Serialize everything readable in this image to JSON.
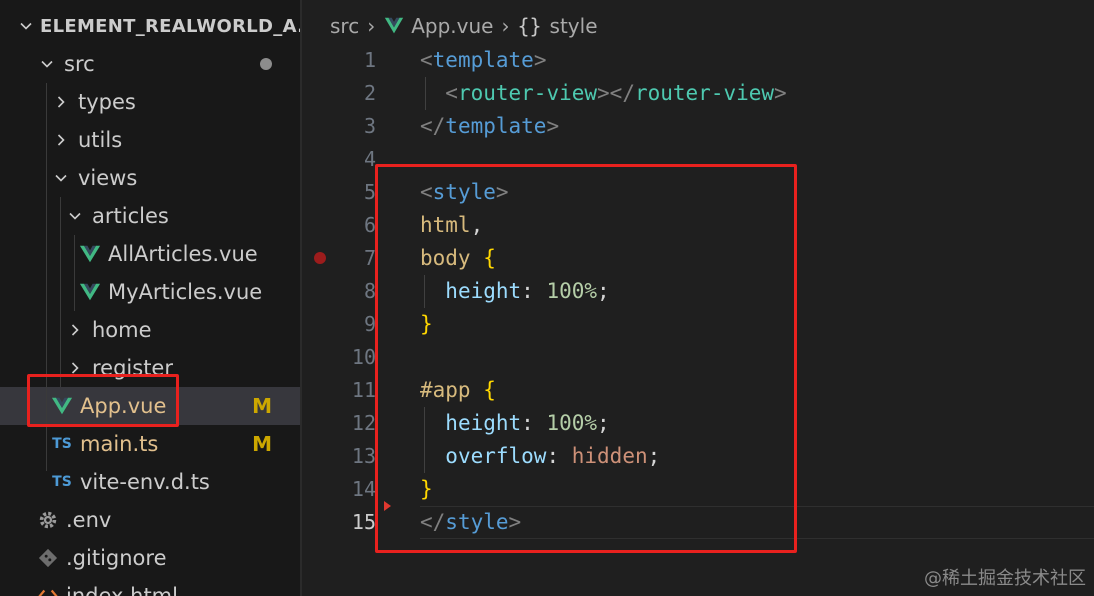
{
  "explorer": {
    "root_label": "ELEMENT_REALWORLD_A...",
    "items": [
      {
        "label": "src",
        "kind": "folder-open",
        "indent": 1
      },
      {
        "label": "types",
        "kind": "folder-closed",
        "indent": 2
      },
      {
        "label": "utils",
        "kind": "folder-closed",
        "indent": 2
      },
      {
        "label": "views",
        "kind": "folder-open",
        "indent": 2
      },
      {
        "label": "articles",
        "kind": "folder-open",
        "indent": 3
      },
      {
        "label": "AllArticles.vue",
        "kind": "vue",
        "indent": 4
      },
      {
        "label": "MyArticles.vue",
        "kind": "vue",
        "indent": 4
      },
      {
        "label": "home",
        "kind": "folder-closed",
        "indent": 3
      },
      {
        "label": "register",
        "kind": "folder-closed",
        "indent": 3
      },
      {
        "label": "App.vue",
        "kind": "vue",
        "indent": 2,
        "git": "M",
        "selected": true
      },
      {
        "label": "main.ts",
        "kind": "ts",
        "indent": 2,
        "git": "M"
      },
      {
        "label": "vite-env.d.ts",
        "kind": "ts",
        "indent": 2
      },
      {
        "label": ".env",
        "kind": "gear",
        "indent": 1
      },
      {
        "label": ".gitignore",
        "kind": "git",
        "indent": 1
      },
      {
        "label": "index.html",
        "kind": "html",
        "indent": 1
      }
    ],
    "ts_icon_text": "TS"
  },
  "breadcrumb": {
    "folder": "src",
    "file": "App.vue",
    "symbol_icon": "{}",
    "symbol": "style"
  },
  "code": {
    "active_line": 15,
    "lines": [
      [
        {
          "t": "<",
          "c": "#808080"
        },
        {
          "t": "template",
          "c": "#569cd6"
        },
        {
          "t": ">",
          "c": "#808080"
        }
      ],
      [
        {
          "t": "  ",
          "c": "#d4d4d4"
        },
        {
          "t": "<",
          "c": "#808080"
        },
        {
          "t": "router-view",
          "c": "#4ec9b0"
        },
        {
          "t": "></",
          "c": "#808080"
        },
        {
          "t": "router-view",
          "c": "#4ec9b0"
        },
        {
          "t": ">",
          "c": "#808080"
        }
      ],
      [
        {
          "t": "</",
          "c": "#808080"
        },
        {
          "t": "template",
          "c": "#569cd6"
        },
        {
          "t": ">",
          "c": "#808080"
        }
      ],
      [],
      [
        {
          "t": "<",
          "c": "#808080"
        },
        {
          "t": "style",
          "c": "#569cd6"
        },
        {
          "t": ">",
          "c": "#808080"
        }
      ],
      [
        {
          "t": "html",
          "c": "#d7ba7d"
        },
        {
          "t": ",",
          "c": "#d4d4d4"
        }
      ],
      [
        {
          "t": "body",
          "c": "#d7ba7d"
        },
        {
          "t": " ",
          "c": "#d4d4d4"
        },
        {
          "t": "{",
          "c": "#ffd700"
        }
      ],
      [
        {
          "t": "  ",
          "c": "#d4d4d4"
        },
        {
          "t": "height",
          "c": "#9cdcfe"
        },
        {
          "t": ": ",
          "c": "#d4d4d4"
        },
        {
          "t": "100%",
          "c": "#b5cea8"
        },
        {
          "t": ";",
          "c": "#d4d4d4"
        }
      ],
      [
        {
          "t": "}",
          "c": "#ffd700"
        }
      ],
      [],
      [
        {
          "t": "#app",
          "c": "#d7ba7d"
        },
        {
          "t": " ",
          "c": "#d4d4d4"
        },
        {
          "t": "{",
          "c": "#ffd700"
        }
      ],
      [
        {
          "t": "  ",
          "c": "#d4d4d4"
        },
        {
          "t": "height",
          "c": "#9cdcfe"
        },
        {
          "t": ": ",
          "c": "#d4d4d4"
        },
        {
          "t": "100%",
          "c": "#b5cea8"
        },
        {
          "t": ";",
          "c": "#d4d4d4"
        }
      ],
      [
        {
          "t": "  ",
          "c": "#d4d4d4"
        },
        {
          "t": "overflow",
          "c": "#9cdcfe"
        },
        {
          "t": ": ",
          "c": "#d4d4d4"
        },
        {
          "t": "hidden",
          "c": "#ce9178"
        },
        {
          "t": ";",
          "c": "#d4d4d4"
        }
      ],
      [
        {
          "t": "}",
          "c": "#ffd700"
        }
      ],
      [
        {
          "t": "</",
          "c": "#808080"
        },
        {
          "t": "style",
          "c": "#569cd6"
        },
        {
          "t": ">",
          "c": "#808080"
        }
      ]
    ],
    "breakpoint_line": 7,
    "fold_marker_line": 14
  },
  "colors": {
    "accent_vue": "#41b883",
    "git_modified": "#cca700",
    "highlight_box": "#e8211e"
  },
  "watermark": "@稀土掘金技术社区"
}
